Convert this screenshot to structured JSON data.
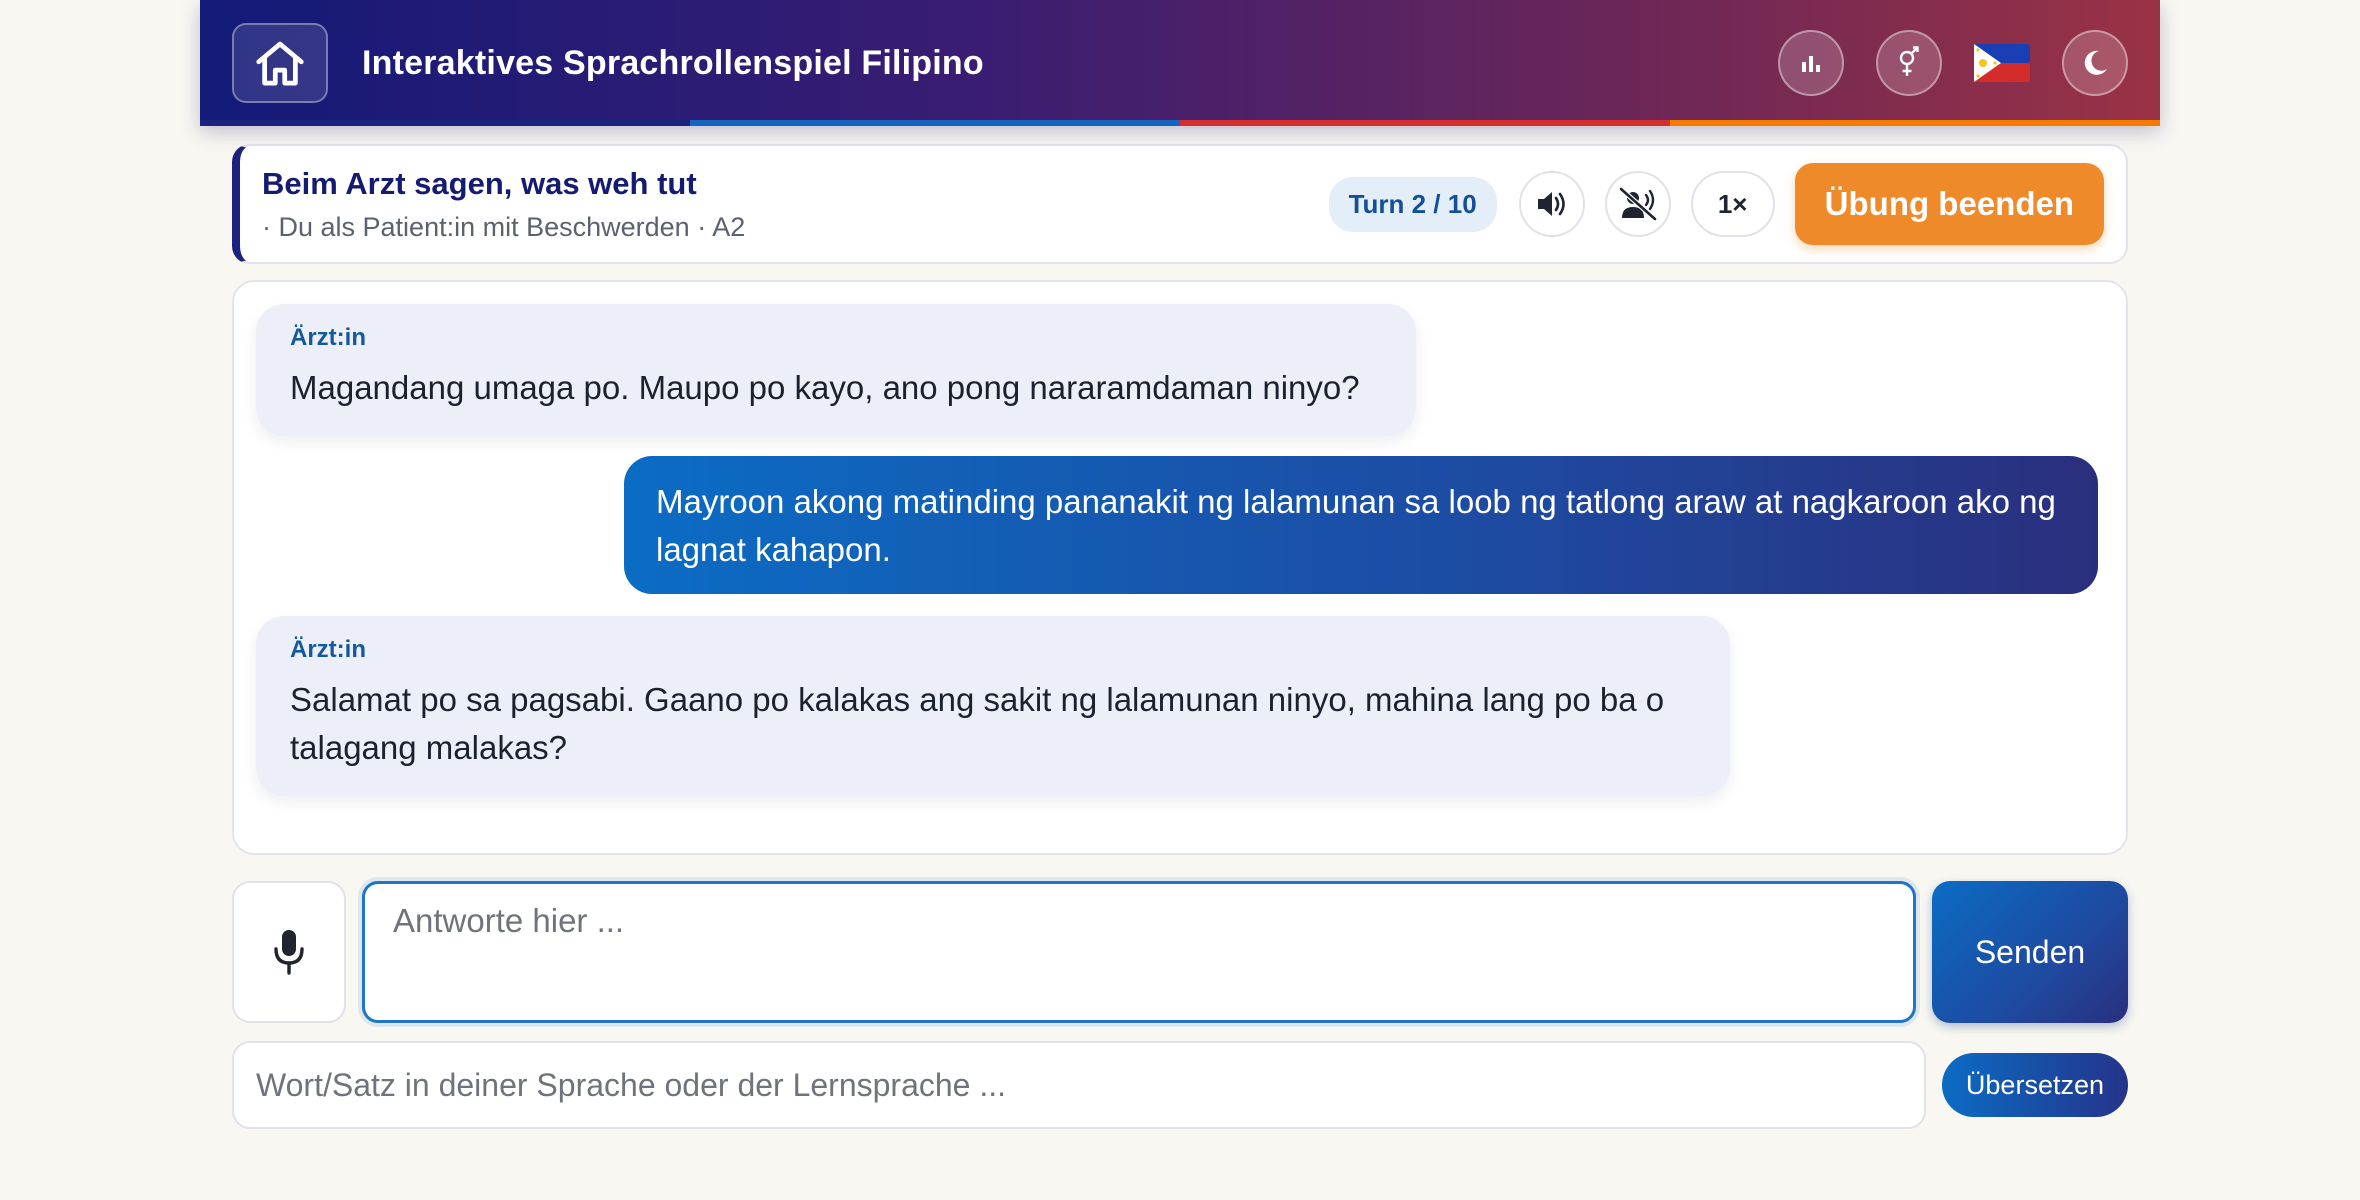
{
  "header": {
    "title": "Interaktives Sprachrollenspiel Filipino",
    "icons": [
      "home-icon",
      "stats-icon",
      "gender-icon",
      "philippines-flag-icon",
      "moon-icon"
    ]
  },
  "stripe_colors": [
    "#1a237e",
    "#1565c0",
    "#d32f2f",
    "#f57c00"
  ],
  "scenario": {
    "title": "Beim Arzt sagen, was weh tut",
    "subtitle": "· Du als Patient:in mit Beschwerden · A2",
    "turn": "Turn 2 / 10",
    "speed": "1×",
    "end_label": "Übung beenden"
  },
  "messages": [
    {
      "role": "bot",
      "speaker": "Ärzt:in",
      "text": "Magandang umaga po. Maupo po kayo, ano pong nararamdaman ninyo?"
    },
    {
      "role": "user",
      "text": "Mayroon akong matinding pananakit ng lalamunan sa loob ng tatlong araw at nagkaroon ako ng lagnat kahapon."
    },
    {
      "role": "bot",
      "speaker": "Ärzt:in",
      "text": "Salamat po sa pagsabi. Gaano po kalakas ang sakit ng lalamunan ninyo, mahina lang po ba o talagang malakas?"
    }
  ],
  "input": {
    "placeholder": "Antworte hier ...",
    "value": "",
    "send_label": "Senden"
  },
  "translate": {
    "placeholder": "Wort/Satz in deiner Sprache oder der Lernsprache ...",
    "button_label": "Übersetzen"
  },
  "colors": {
    "accent": "#1f76c9",
    "end_button": "#ee8a2a",
    "header_start": "#131a78",
    "header_end": "#9a3245"
  }
}
